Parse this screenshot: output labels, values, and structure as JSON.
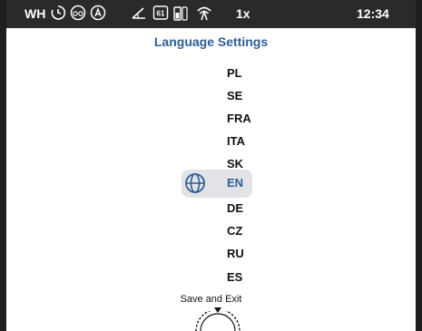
{
  "status_bar": {
    "profile": "WH",
    "speed": "1x",
    "time": "12:34",
    "icons": [
      "clock-cycle-icon",
      "bike-icon",
      "auto-mode-icon",
      "angle-icon",
      "gear-61-icon",
      "battery-icon",
      "signal-icon"
    ]
  },
  "title": "Language Settings",
  "languages": [
    {
      "code": "PL"
    },
    {
      "code": "SE"
    },
    {
      "code": "FRA"
    },
    {
      "code": "ITA"
    },
    {
      "code": "SK"
    },
    {
      "code": "EN"
    },
    {
      "code": "DE"
    },
    {
      "code": "CZ"
    },
    {
      "code": "RU"
    },
    {
      "code": "ES"
    }
  ],
  "selected_language": "EN",
  "selected_icon": "globe-icon",
  "save_exit_label": "Save and Exit",
  "colors": {
    "accent": "#2e5f96",
    "status_bar_bg": "#2a2a2a",
    "highlight_bg": "#e2e3e7"
  }
}
